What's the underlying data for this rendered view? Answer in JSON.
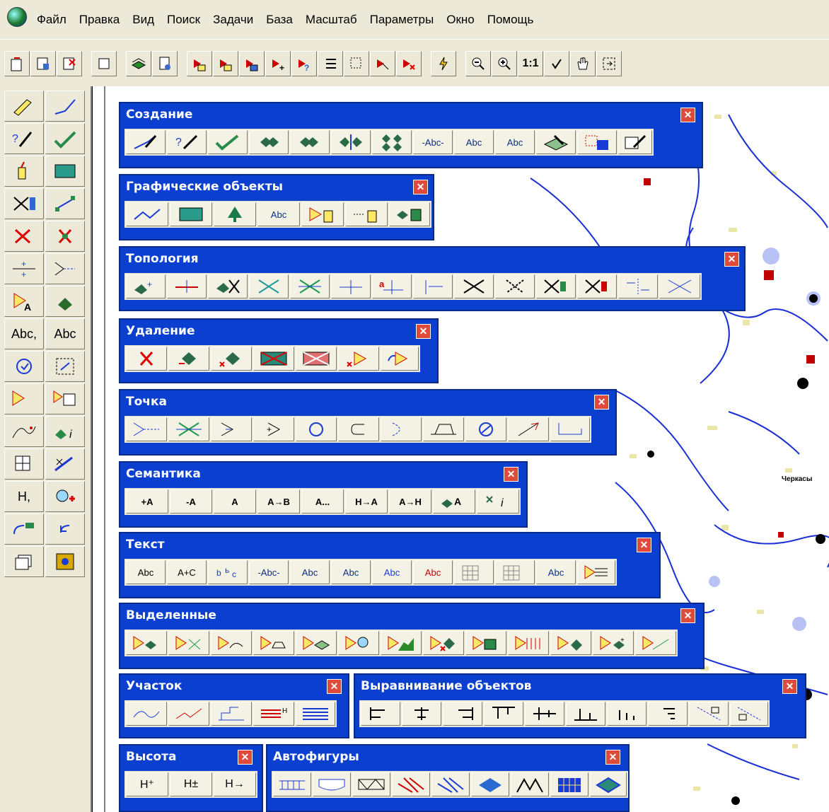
{
  "menu": [
    "Файл",
    "Правка",
    "Вид",
    "Поиск",
    "Задачи",
    "База",
    "Масштаб",
    "Параметры",
    "Окно",
    "Помощь"
  ],
  "toolbar": {
    "zoom_label": "1:1"
  },
  "left_panel": {
    "text_labels": [
      "Abc,",
      "Abc",
      "H,"
    ]
  },
  "map_labels": [
    "Черкасы"
  ],
  "panels": {
    "sozdanie": {
      "title": "Создание",
      "btn_text": [
        "-Abc-",
        "Abc",
        "Abc"
      ]
    },
    "graphic": {
      "title": "Графические объекты",
      "btn_text": [
        "Abc"
      ]
    },
    "topology": {
      "title": "Топология"
    },
    "delete": {
      "title": "Удаление"
    },
    "point": {
      "title": "Точка"
    },
    "semantics": {
      "title": "Семантика",
      "btn_text": [
        "+A",
        "-A",
        "A",
        "A→B",
        "A...",
        "H→A",
        "A→H"
      ]
    },
    "text": {
      "title": "Текст",
      "btn_text": [
        "Abc",
        "A+C",
        "-Abc-",
        "Abc",
        "Abc",
        "Abc",
        "Abc",
        "Abc"
      ]
    },
    "selected": {
      "title": "Выделенные"
    },
    "plot": {
      "title": "Участок"
    },
    "align": {
      "title": "Выравнивание объектов"
    },
    "height": {
      "title": "Высота",
      "btn_text": [
        "H⁺",
        "H±",
        "H→"
      ]
    },
    "autoshapes": {
      "title": "Автофигуры"
    }
  },
  "colors": {
    "panel_blue": "#0a3fd0",
    "close_red": "#e04a3a",
    "map_river": "#1a2fd6",
    "map_marker": "#c00000"
  }
}
